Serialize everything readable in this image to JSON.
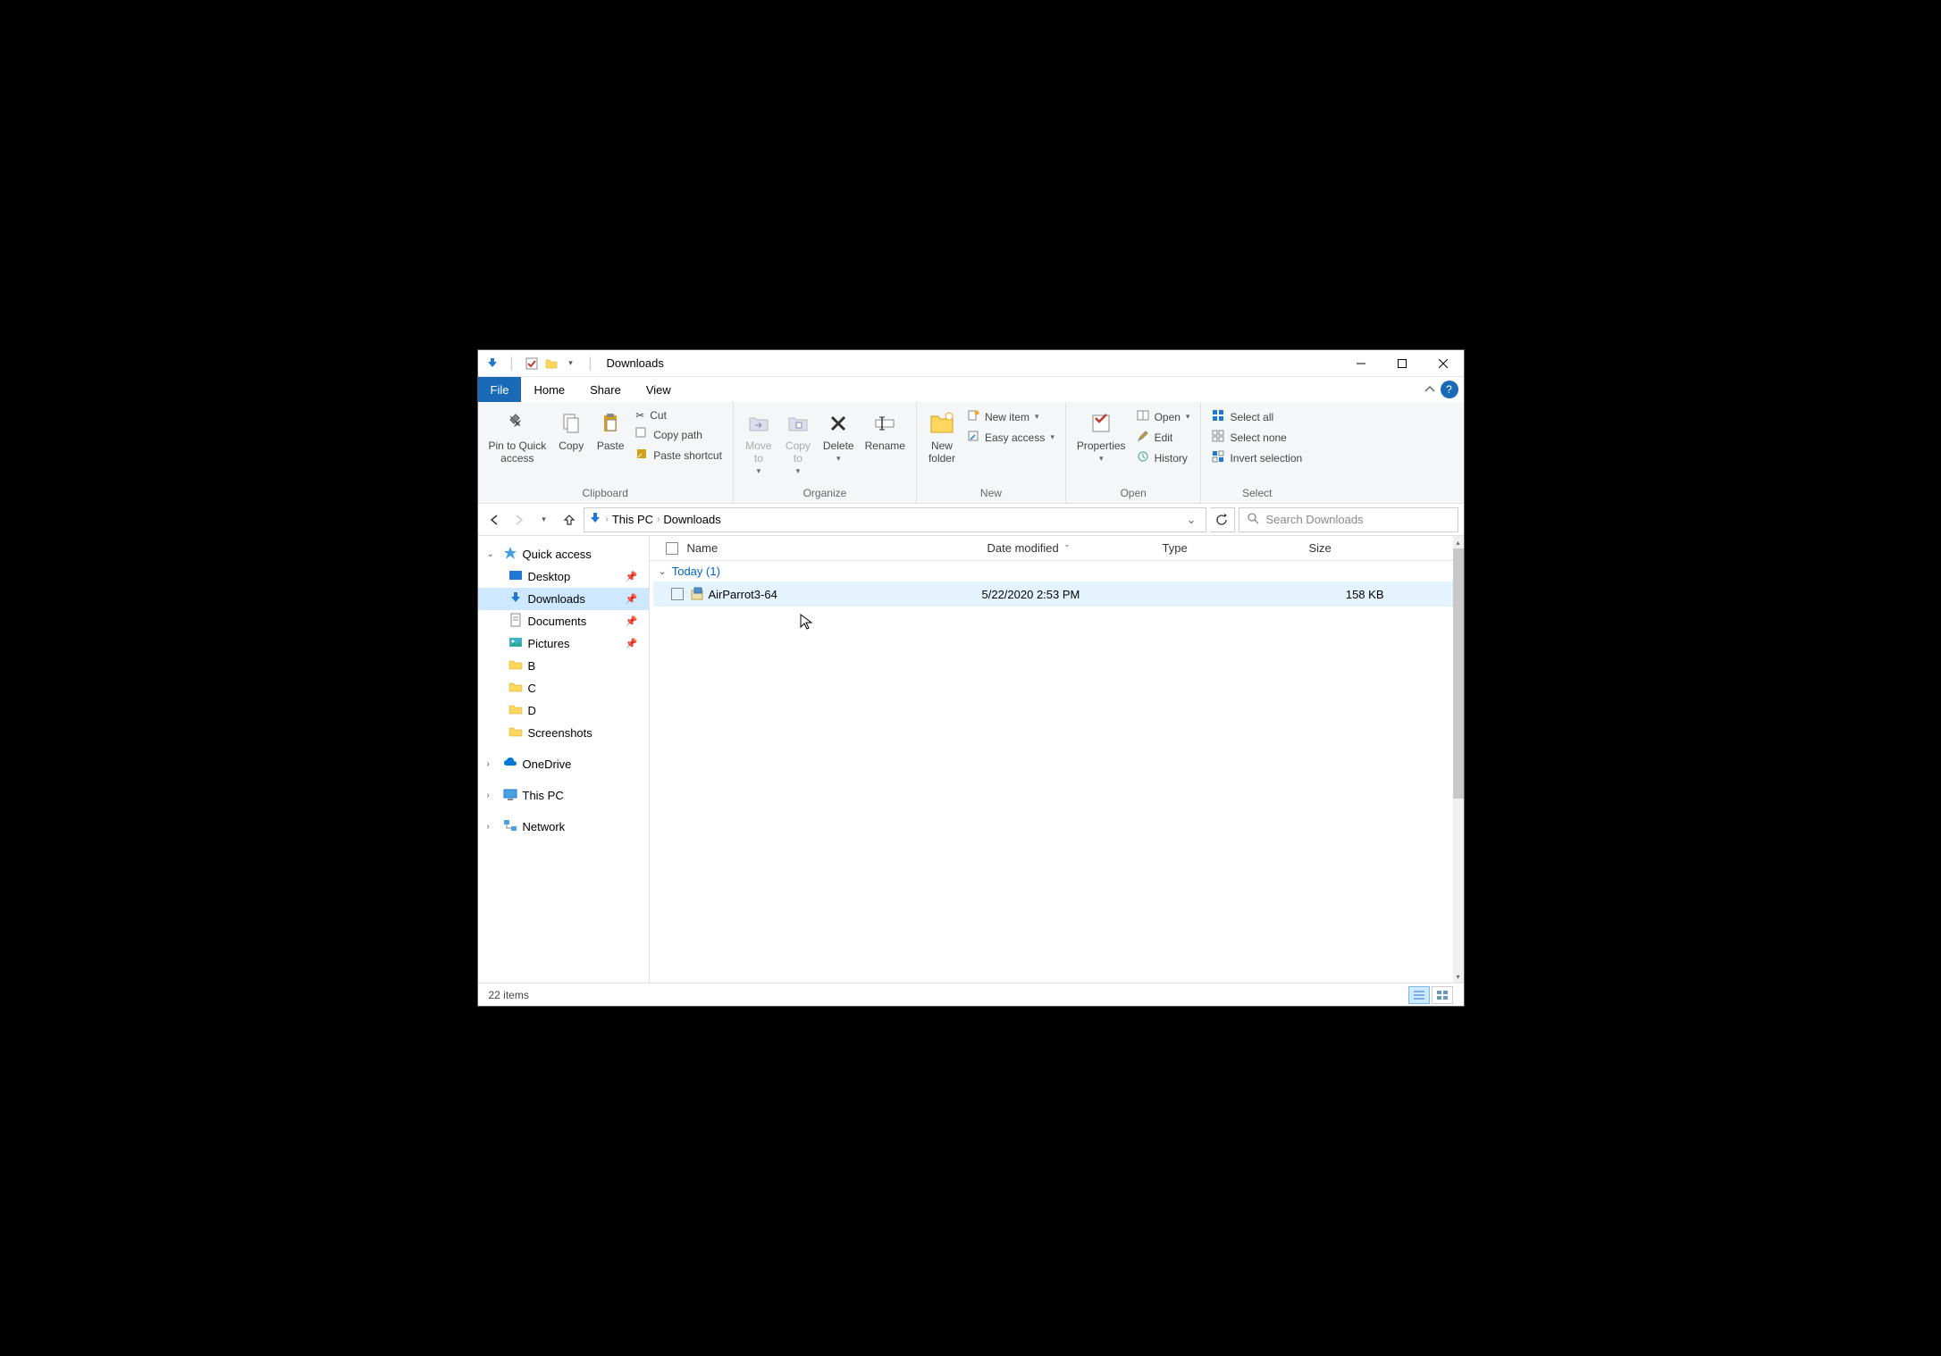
{
  "window": {
    "title": "Downloads"
  },
  "tabs": {
    "file": "File",
    "home": "Home",
    "share": "Share",
    "view": "View"
  },
  "ribbon": {
    "clipboard": {
      "pin": "Pin to Quick\naccess",
      "copy": "Copy",
      "paste": "Paste",
      "cut": "Cut",
      "copypath": "Copy path",
      "pasteshortcut": "Paste shortcut",
      "label": "Clipboard"
    },
    "organize": {
      "moveto": "Move\nto",
      "copyto": "Copy\nto",
      "delete": "Delete",
      "rename": "Rename",
      "label": "Organize"
    },
    "new": {
      "newfolder": "New\nfolder",
      "newitem": "New item",
      "easyaccess": "Easy access",
      "label": "New"
    },
    "open": {
      "properties": "Properties",
      "open": "Open",
      "edit": "Edit",
      "history": "History",
      "label": "Open"
    },
    "select": {
      "selectall": "Select all",
      "selectnone": "Select none",
      "invert": "Invert selection",
      "label": "Select"
    }
  },
  "breadcrumb": {
    "thispc": "This PC",
    "downloads": "Downloads"
  },
  "search": {
    "placeholder": "Search Downloads"
  },
  "tree": {
    "quickaccess": "Quick access",
    "desktop": "Desktop",
    "downloads": "Downloads",
    "documents": "Documents",
    "pictures": "Pictures",
    "b": "B",
    "c": "C",
    "d": "D",
    "screenshots": "Screenshots",
    "onedrive": "OneDrive",
    "thispc": "This PC",
    "network": "Network"
  },
  "columns": {
    "name": "Name",
    "date": "Date modified",
    "type": "Type",
    "size": "Size"
  },
  "group": {
    "today": "Today (1)"
  },
  "files": [
    {
      "name": "AirParrot3-64",
      "date": "5/22/2020 2:53 PM",
      "type": "",
      "size": "158 KB"
    }
  ],
  "status": {
    "items": "22 items"
  }
}
